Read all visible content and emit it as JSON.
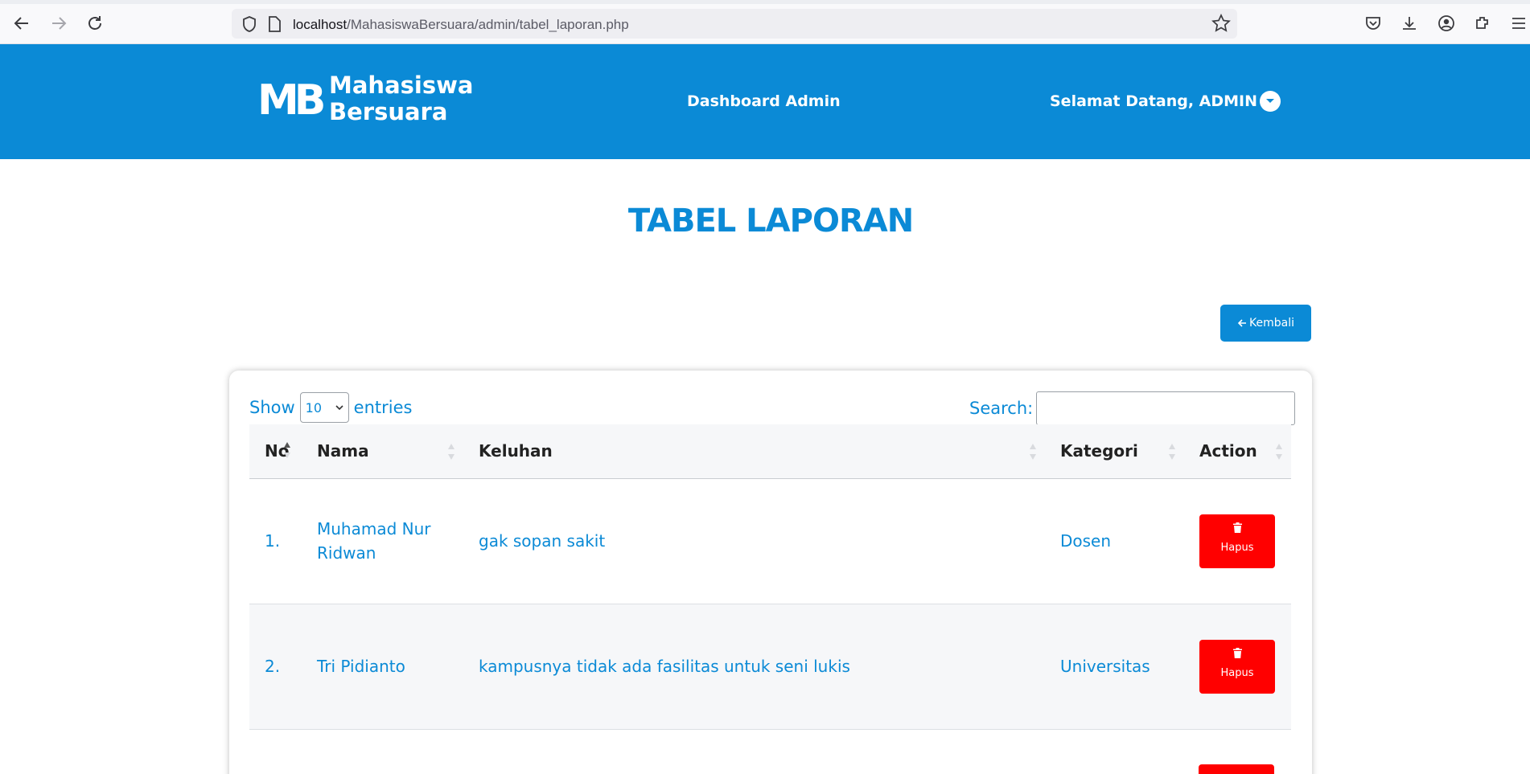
{
  "browser": {
    "url_host": "localhost",
    "url_path": "/MahasiswaBersuara/admin/tabel_laporan.php"
  },
  "header": {
    "logo_mark": "MB",
    "logo_line1": "Mahasiswa",
    "logo_line2": "Bersuara",
    "nav_title": "Dashboard Admin",
    "greeting": "Selamat Datang, ADMIN"
  },
  "page": {
    "title": "TABEL LAPORAN",
    "back_button": "Kembali"
  },
  "table_controls": {
    "show_label": "Show",
    "entries_value": "10",
    "entries_label": "entries",
    "search_label": "Search:",
    "search_value": ""
  },
  "table": {
    "columns": [
      "No",
      "Nama",
      "Keluhan",
      "Kategori",
      "Action"
    ],
    "rows": [
      {
        "no": "1.",
        "nama": "Muhamad Nur Ridwan",
        "keluhan": "gak sopan sakit",
        "kategori": "Dosen",
        "action": "Hapus"
      },
      {
        "no": "2.",
        "nama": "Tri Pidianto",
        "keluhan": "kampusnya tidak ada fasilitas untuk seni lukis",
        "kategori": "Universitas",
        "action": "Hapus"
      }
    ]
  },
  "colors": {
    "brand": "#0b8ad6",
    "danger": "#ff0000"
  }
}
